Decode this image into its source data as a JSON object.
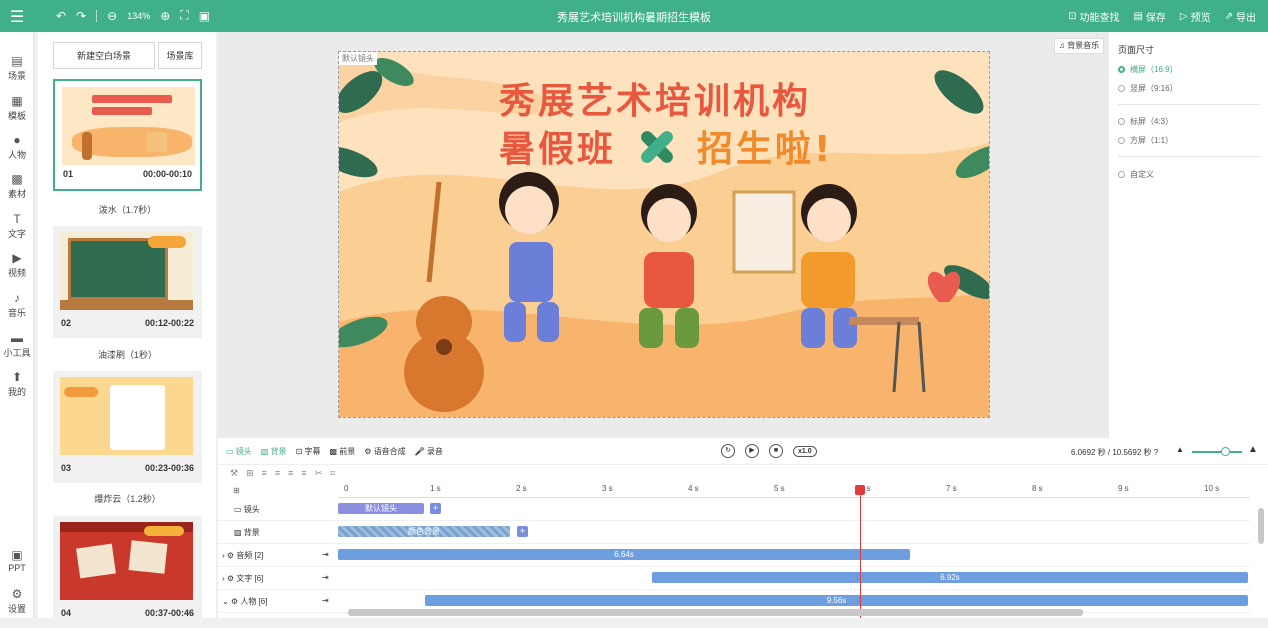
{
  "header": {
    "title": "秀展艺术培训机构暑期招生模板",
    "zoom": "134%",
    "actions": [
      "功能查找",
      "保存",
      "预览",
      "导出"
    ]
  },
  "left_nav": [
    "场景",
    "模板",
    "人物",
    "素材",
    "文字",
    "视频",
    "音乐",
    "小工具",
    "我的",
    "PPT",
    "设置"
  ],
  "scenes": {
    "new_blank": "新建空白场景",
    "library": "场景库",
    "items": [
      {
        "num": "01",
        "time": "00:00-00:10",
        "transition": "泼水（1.7秒）"
      },
      {
        "num": "02",
        "time": "00:12-00:22",
        "transition": "油漆刷（1秒）"
      },
      {
        "num": "03",
        "time": "00:23-00:36",
        "transition": "爆炸云（1.2秒）"
      },
      {
        "num": "04",
        "time": "00:37-00:46"
      }
    ]
  },
  "canvas": {
    "bgm_button": "背景音乐",
    "default_lens_tag": "默认镜头",
    "headline_line1": "秀展艺术培训机构",
    "headline_line2a": "暑假班",
    "headline_line2b": "招生啦!"
  },
  "page_size": {
    "heading": "页面尺寸",
    "options": [
      {
        "label": "横屏（16:9）",
        "selected": true
      },
      {
        "label": "竖屏（9:16）",
        "selected": false
      },
      {
        "label": "标屏（4:3）",
        "selected": false
      },
      {
        "label": "方屏（1:1）",
        "selected": false
      },
      {
        "label": "自定义",
        "selected": false
      }
    ]
  },
  "timeline": {
    "tabs": [
      "镜头",
      "背景",
      "字幕",
      "前景",
      "语音合成",
      "录音"
    ],
    "speed": "x1.0",
    "time_info": "6.0692 秒 / 10.5692 秒",
    "ruler": [
      "0",
      "1 s",
      "2 s",
      "3 s",
      "4 s",
      "5 s",
      "6 s",
      "7 s",
      "8 s",
      "9 s",
      "10 s"
    ],
    "rows": [
      {
        "label": "镜头",
        "clip": "默认镜头"
      },
      {
        "label": "背景",
        "clip": "颜色背景"
      },
      {
        "label": "音频 [2]",
        "clip": "6.64s"
      },
      {
        "label": "文字 [6]",
        "clip": "6.92s"
      },
      {
        "label": "人物 [6]",
        "clip": "9.56s"
      }
    ]
  }
}
